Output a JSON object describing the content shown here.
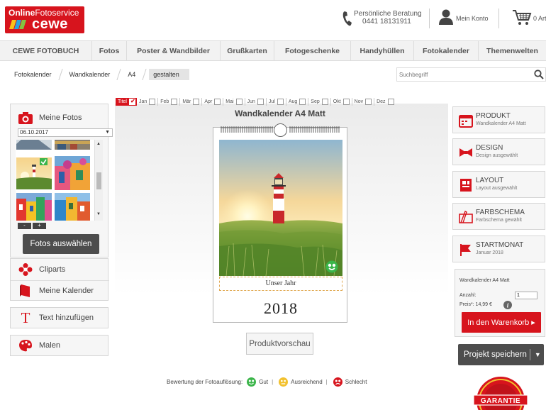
{
  "header": {
    "logo_online": "Online",
    "logo_service": "Fotoservice",
    "logo_brand": "cewe",
    "contact_line1": "Persönliche Beratung",
    "contact_line2": "0441 18131911",
    "account_label": "Mein Konto",
    "cart_label": "0 Art"
  },
  "nav": [
    "CEWE FOTOBUCH",
    "Fotos",
    "Poster & Wandbilder",
    "Grußkarten",
    "Fotogeschenke",
    "Handyhüllen",
    "Fotokalender",
    "Themenwelten"
  ],
  "breadcrumb": [
    "Fotokalender",
    "Wandkalender",
    "A4",
    "gestalten"
  ],
  "search": {
    "placeholder": "Suchbegriff"
  },
  "left_panel": {
    "my_photos": "Meine Fotos",
    "date_filter": "06.10.2017",
    "zoom_out": "-",
    "zoom_in": "+",
    "select_photos": "Fotos auswählen",
    "cliparts": "Cliparts",
    "my_calendars": "Meine Kalender",
    "add_text": "Text hinzufügen",
    "paint": "Malen"
  },
  "months": [
    "Titel",
    "Jan",
    "Feb",
    "Mär",
    "Apr",
    "Mai",
    "Jun",
    "Jul",
    "Aug",
    "Sep",
    "Okt",
    "Nov",
    "Dez"
  ],
  "canvas": {
    "title": "Wandkalender A4 Matt",
    "caption": "Unser Jahr",
    "year": "2018",
    "preview_button": "Produktvorschau"
  },
  "rating": {
    "label": "Bewertung der Fotoauflösung:",
    "good": "Gut",
    "ok": "Ausreichend",
    "bad": "Schlecht"
  },
  "right_panel": [
    {
      "title": "PRODUKT",
      "sub": "Wandkalender A4 Matt"
    },
    {
      "title": "DESIGN",
      "sub": "Design ausgewählt"
    },
    {
      "title": "LAYOUT",
      "sub": "Layout ausgewählt"
    },
    {
      "title": "FARBSCHEMA",
      "sub": "Farbschema gewählt"
    },
    {
      "title": "STARTMONAT",
      "sub": "Januar 2018"
    }
  ],
  "order": {
    "product": "Wandkalender A4 Matt",
    "qty_label": "Anzahl:",
    "qty": "1",
    "price": "Preis*:  14,99 €",
    "cart_button": "In den Warenkorb ▸",
    "save_button": "Projekt speichern"
  },
  "badge_text": "GARANTIE",
  "colors": {
    "brand_red": "#d7141d",
    "dark_button": "#4d4d4d",
    "good": "#3bb54a",
    "ok": "#f2c12e",
    "bad": "#d7141d"
  }
}
